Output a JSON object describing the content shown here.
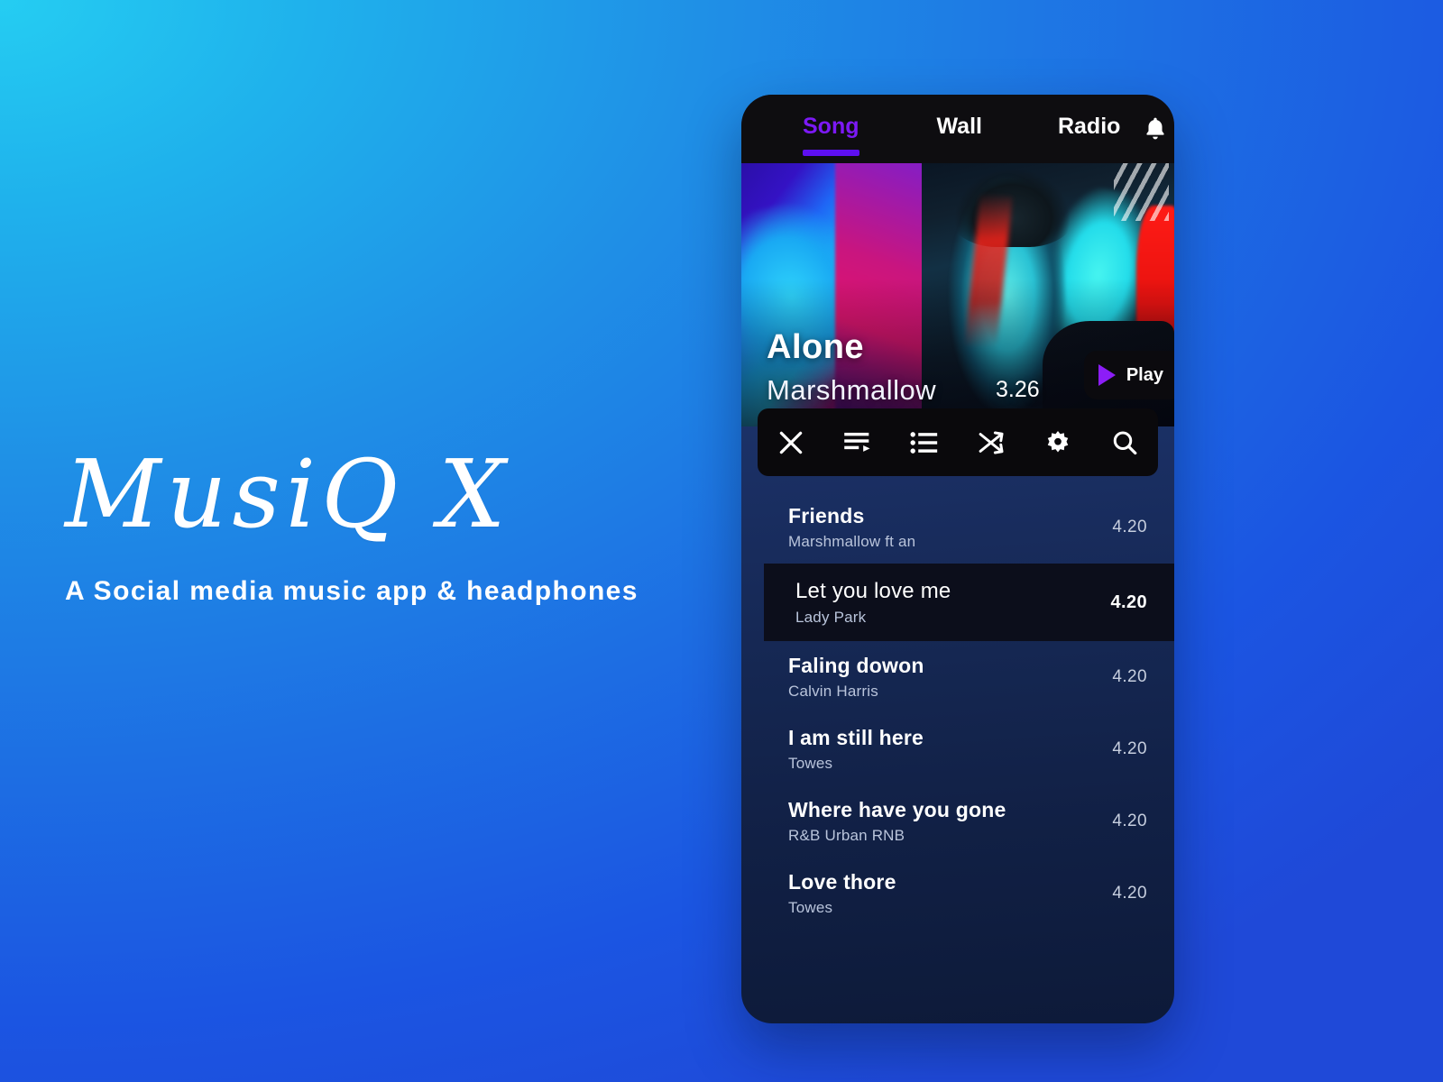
{
  "brand": {
    "logo": "MusiQ X",
    "tagline": "A Social media music app & headphones"
  },
  "colors": {
    "accent_purple": "#7c19f5",
    "underline_purple": "#5d0ff0",
    "bg_cyan": "#25cdf2",
    "bg_blue": "#1f49d8",
    "dark_panel": "#0e0d10",
    "highlight_row": "#0c0e1b"
  },
  "topbar": {
    "menu_icon": "hamburger-icon",
    "bell_icon": "bell-icon",
    "tabs": [
      {
        "label": "Song",
        "active": true
      },
      {
        "label": "Wall",
        "active": false
      },
      {
        "label": "Radio",
        "active": false
      }
    ]
  },
  "hero": {
    "title": "Alone",
    "artist": "Marshmallow",
    "duration": "3.26",
    "play_label": "Play",
    "play_icon": "play-triangle-icon"
  },
  "toolbar": {
    "icons": [
      {
        "name": "close-icon",
        "label": "Close"
      },
      {
        "name": "playlist-play-icon",
        "label": "Play queue"
      },
      {
        "name": "list-icon",
        "label": "List"
      },
      {
        "name": "shuffle-icon",
        "label": "Shuffle"
      },
      {
        "name": "gear-icon",
        "label": "Settings"
      },
      {
        "name": "search-icon",
        "label": "Search"
      }
    ]
  },
  "tracks": [
    {
      "title": "Friends",
      "artist": "Marshmallow ft an",
      "time": "4.20",
      "highlight": false
    },
    {
      "title": "Let you love me",
      "artist": "Lady Park",
      "time": "4.20",
      "highlight": true
    },
    {
      "title": "Faling dowon",
      "artist": "Calvin Harris",
      "time": "4.20",
      "highlight": false
    },
    {
      "title": "I am still here",
      "artist": "Towes",
      "time": "4.20",
      "highlight": false
    },
    {
      "title": "Where have you gone",
      "artist": "R&B Urban RNB",
      "time": "4.20",
      "highlight": false
    },
    {
      "title": "Love thore",
      "artist": "Towes",
      "time": "4.20",
      "highlight": false
    }
  ]
}
